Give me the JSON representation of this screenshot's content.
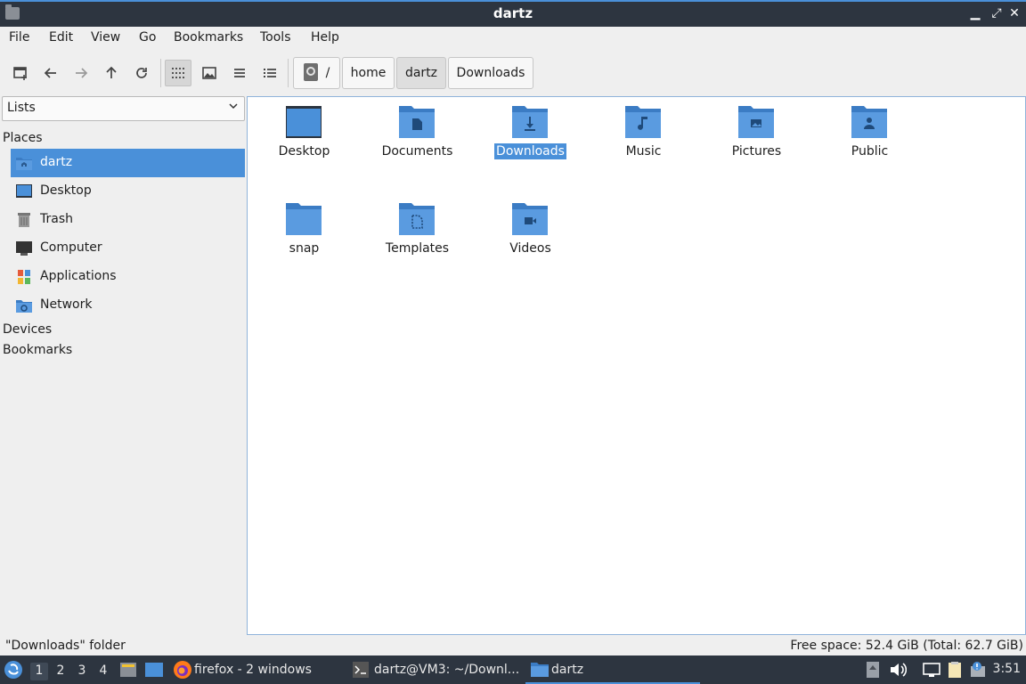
{
  "window": {
    "title": "dartz"
  },
  "menu": [
    "File",
    "Edit",
    "View",
    "Go",
    "Bookmarks",
    "Tools",
    "Help"
  ],
  "toolbar": {
    "buttons": [
      "new-tab-icon",
      "back-icon",
      "forward-icon",
      "up-icon",
      "reload-icon",
      "icon-view-icon",
      "thumbnail-view-icon",
      "compact-view-icon",
      "detailed-list-view-icon"
    ]
  },
  "breadcrumb": {
    "root": "/",
    "items": [
      "home",
      "dartz",
      "Downloads"
    ]
  },
  "sidebar": {
    "mode": "Lists",
    "sections": {
      "places": "Places",
      "devices": "Devices",
      "bookmarks": "Bookmarks"
    },
    "items": [
      {
        "label": "dartz",
        "icon": "home-folder-icon"
      },
      {
        "label": "Desktop",
        "icon": "desktop-icon"
      },
      {
        "label": "Trash",
        "icon": "trash-icon"
      },
      {
        "label": "Computer",
        "icon": "computer-icon"
      },
      {
        "label": "Applications",
        "icon": "applications-icon"
      },
      {
        "label": "Network",
        "icon": "network-icon"
      }
    ]
  },
  "files": [
    {
      "name": "Desktop",
      "icon": "desktop-folder-icon"
    },
    {
      "name": "Documents",
      "icon": "documents-folder-icon"
    },
    {
      "name": "Downloads",
      "icon": "downloads-folder-icon",
      "selected": true
    },
    {
      "name": "Music",
      "icon": "music-folder-icon"
    },
    {
      "name": "Pictures",
      "icon": "pictures-folder-icon"
    },
    {
      "name": "Public",
      "icon": "public-folder-icon"
    },
    {
      "name": "snap",
      "icon": "folder-icon"
    },
    {
      "name": "Templates",
      "icon": "templates-folder-icon"
    },
    {
      "name": "Videos",
      "icon": "videos-folder-icon"
    }
  ],
  "status": {
    "selection": "\"Downloads\" folder",
    "free_space": "Free space: 52.4 GiB (Total: 62.7 GiB)"
  },
  "taskbar": {
    "desktops": [
      "1",
      "2",
      "3",
      "4"
    ],
    "tasks": [
      "firefox - 2 windows",
      "dartz@VM3: ~/Downl...",
      "dartz"
    ],
    "clock": "3:51"
  },
  "colors": {
    "accent": "#4a90d9",
    "folder": "#4a90d9",
    "titlebar": "#2d3540"
  }
}
